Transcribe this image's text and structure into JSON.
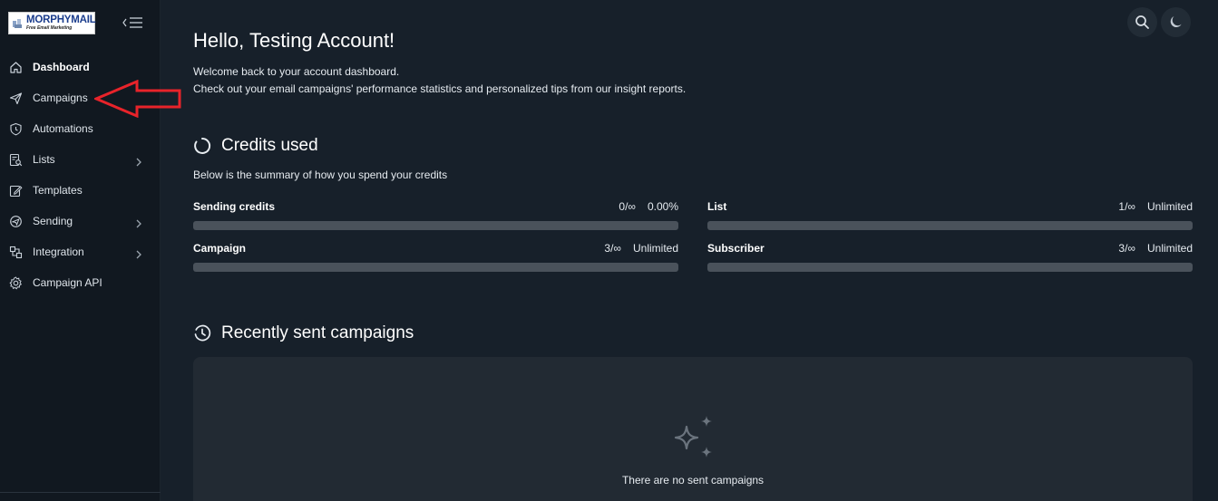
{
  "brand": {
    "name": "MORPHYMAIL",
    "tagline": "Free Email Marketing"
  },
  "sidebar": {
    "items": [
      {
        "label": "Dashboard",
        "icon": "home-icon",
        "active": true,
        "has_submenu": false
      },
      {
        "label": "Campaigns",
        "icon": "send-icon",
        "active": false,
        "has_submenu": false
      },
      {
        "label": "Automations",
        "icon": "shield-clock-icon",
        "active": false,
        "has_submenu": false
      },
      {
        "label": "Lists",
        "icon": "list-search-icon",
        "active": false,
        "has_submenu": true
      },
      {
        "label": "Templates",
        "icon": "edit-icon",
        "active": false,
        "has_submenu": false
      },
      {
        "label": "Sending",
        "icon": "globe-send-icon",
        "active": false,
        "has_submenu": true
      },
      {
        "label": "Integration",
        "icon": "plug-icon",
        "active": false,
        "has_submenu": true
      },
      {
        "label": "Campaign API",
        "icon": "gear-icon",
        "active": false,
        "has_submenu": false
      }
    ]
  },
  "header": {
    "greeting": "Hello, Testing Account!",
    "welcome_line1": "Welcome back to your account dashboard.",
    "welcome_line2": "Check out your email campaigns' performance statistics and personalized tips from our insight reports."
  },
  "credits": {
    "title": "Credits used",
    "description": "Below is the summary of how you spend your credits",
    "stats": [
      {
        "name": "Sending credits",
        "usage": "0/∞",
        "value": "0.00%",
        "fraction": 0
      },
      {
        "name": "List",
        "usage": "1/∞",
        "value": "Unlimited",
        "fraction": 0
      },
      {
        "name": "Campaign",
        "usage": "3/∞",
        "value": "Unlimited",
        "fraction": 0
      },
      {
        "name": "Subscriber",
        "usage": "3/∞",
        "value": "Unlimited",
        "fraction": 0
      }
    ]
  },
  "recent": {
    "title": "Recently sent campaigns",
    "empty_text": "There are no sent campaigns"
  },
  "colors": {
    "background": "#17202a",
    "sidebar": "#111820",
    "bar_track": "#4a525b",
    "annotation": "#e8232a"
  }
}
